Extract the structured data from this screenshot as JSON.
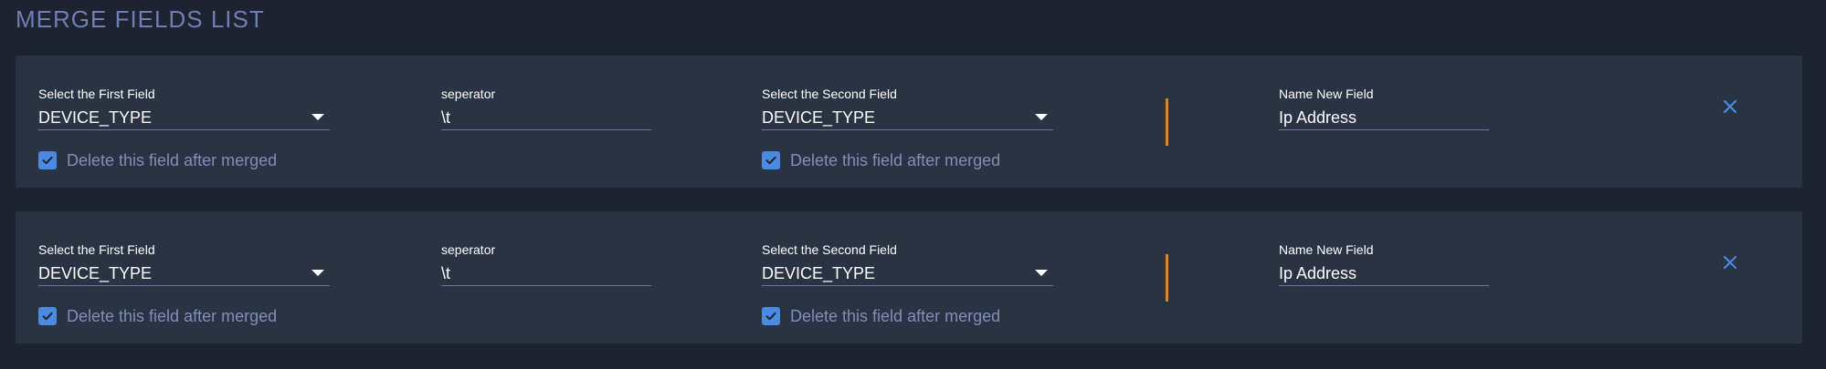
{
  "section": {
    "title": "MERGE FIELDS LIST"
  },
  "colors": {
    "background": "#1e2332",
    "card": "#2a3344",
    "accent_checkbox": "#4a8be0",
    "accent_divider": "#d08b2c",
    "title": "#6f7fb2",
    "muted_text": "#7f8fb5"
  },
  "rows": [
    {
      "first_field": {
        "label": "Select the First Field",
        "value": "DEVICE_TYPE",
        "icon": "chevron-down-icon"
      },
      "separator": {
        "label": "seperator",
        "value": "\\t"
      },
      "second_field": {
        "label": "Select the Second Field",
        "value": "DEVICE_TYPE",
        "icon": "chevron-down-icon"
      },
      "new_field": {
        "label": "Name New Field",
        "value": "Ip Address"
      },
      "delete_first": {
        "label": "Delete this field after merged",
        "checked": true
      },
      "delete_second": {
        "label": "Delete this field after merged",
        "checked": true
      },
      "remove_icon": "close-icon"
    },
    {
      "first_field": {
        "label": "Select the First Field",
        "value": "DEVICE_TYPE",
        "icon": "chevron-down-icon"
      },
      "separator": {
        "label": "seperator",
        "value": "\\t"
      },
      "second_field": {
        "label": "Select the Second Field",
        "value": "DEVICE_TYPE",
        "icon": "chevron-down-icon"
      },
      "new_field": {
        "label": "Name New Field",
        "value": "Ip Address"
      },
      "delete_first": {
        "label": "Delete this field after merged",
        "checked": true
      },
      "delete_second": {
        "label": "Delete this field after merged",
        "checked": true
      },
      "remove_icon": "close-icon"
    }
  ]
}
